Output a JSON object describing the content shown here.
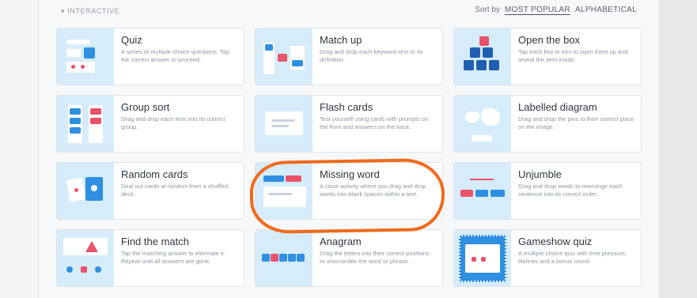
{
  "section_label": "▾ INTERACTIVE",
  "sort": {
    "label": "Sort by",
    "options": [
      "MOST POPULAR",
      "ALPHABETICAL"
    ]
  },
  "cards": [
    {
      "title": "Quiz",
      "desc": "A series of multiple choice questions. Tap the correct answer to proceed."
    },
    {
      "title": "Match up",
      "desc": "Drag and drop each keyword next to its definition."
    },
    {
      "title": "Open the box",
      "desc": "Tap each box in turn to open them up and reveal the item inside."
    },
    {
      "title": "Group sort",
      "desc": "Drag and drop each item into its correct group."
    },
    {
      "title": "Flash cards",
      "desc": "Test yourself using cards with prompts on the front and answers on the back."
    },
    {
      "title": "Labelled diagram",
      "desc": "Drag and drop the pins to their correct place on the image."
    },
    {
      "title": "Random cards",
      "desc": "Deal out cards at random from a shuffled deck."
    },
    {
      "title": "Missing word",
      "desc": "A cloze activity where you drag and drop words into blank spaces within a text."
    },
    {
      "title": "Unjumble",
      "desc": "Drag and drop words to rearrange each sentence into its correct order."
    },
    {
      "title": "Find the match",
      "desc": "Tap the matching answer to eliminate it. Repeat until all answers are gone."
    },
    {
      "title": "Anagram",
      "desc": "Drag the letters into their correct positions to unscramble the word or phrase."
    },
    {
      "title": "Gameshow quiz",
      "desc": "A multiple choice quiz with time pressure, lifelines and a bonus round."
    }
  ],
  "colors": {
    "accent": "#2f8fe0",
    "highlight": "#f06a1b",
    "thumb_bg": "#d6ecfa"
  }
}
